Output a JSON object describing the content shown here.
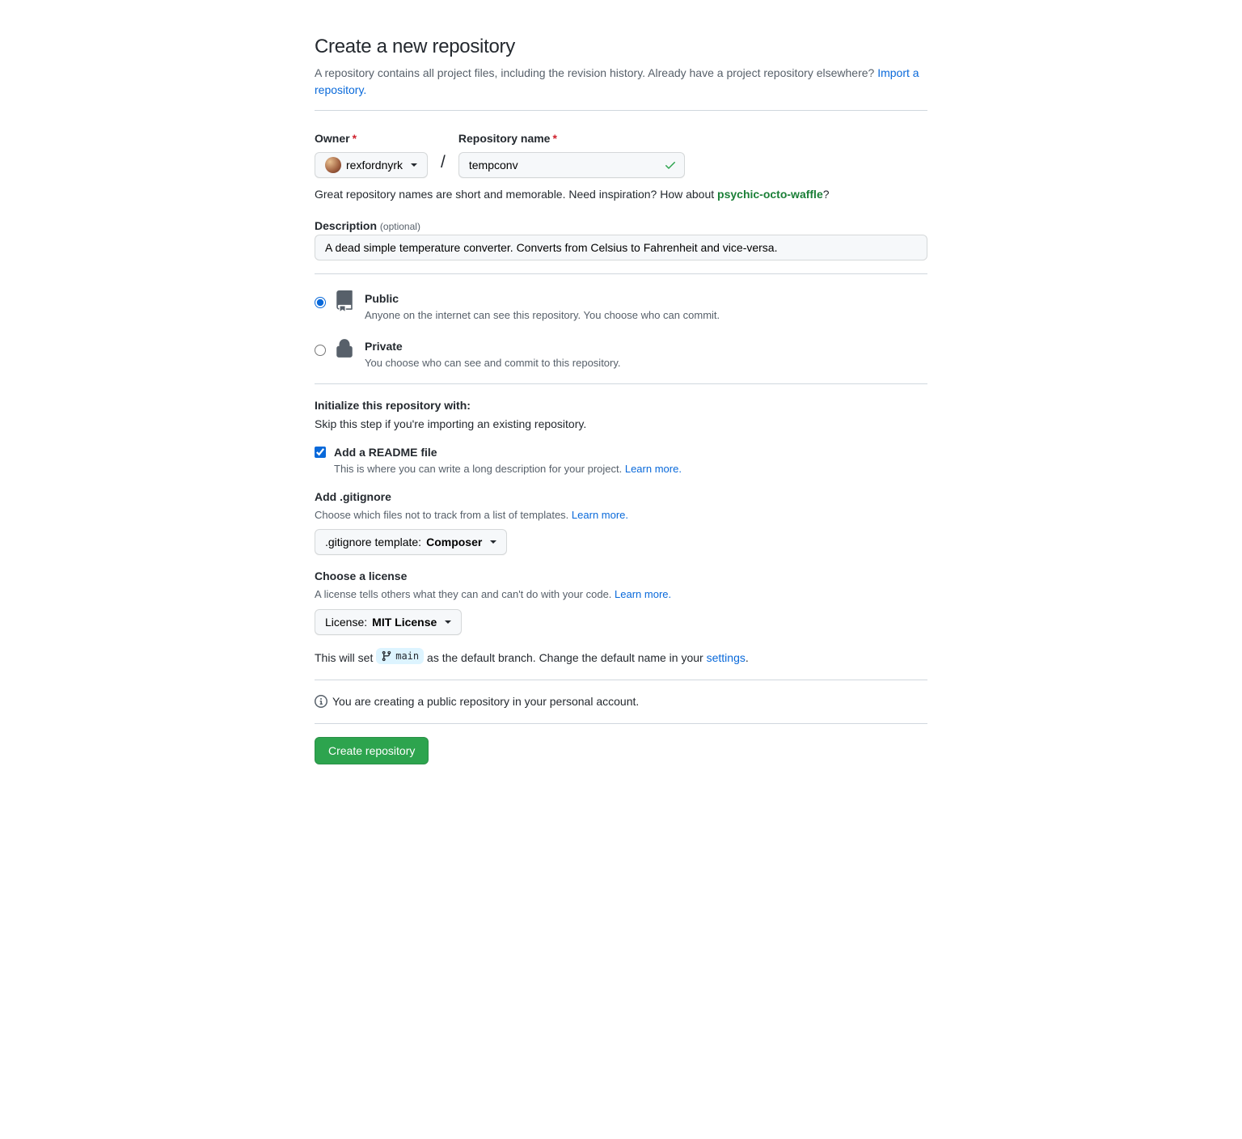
{
  "header": {
    "title": "Create a new repository",
    "subtitle_prefix": "A repository contains all project files, including the revision history. Already have a project repository elsewhere? ",
    "import_link": "Import a repository."
  },
  "owner": {
    "label": "Owner",
    "value": "rexfordnyrk"
  },
  "repo_name": {
    "label": "Repository name",
    "value": "tempconv"
  },
  "name_hint": {
    "prefix": "Great repository names are short and memorable. Need inspiration? How about ",
    "suggestion": "psychic-octo-waffle",
    "suffix": "?"
  },
  "description": {
    "label": "Description",
    "optional": "(optional)",
    "value": "A dead simple temperature converter. Converts from Celsius to Fahrenheit and vice-versa."
  },
  "visibility": {
    "public": {
      "label": "Public",
      "sub": "Anyone on the internet can see this repository. You choose who can commit."
    },
    "private": {
      "label": "Private",
      "sub": "You choose who can see and commit to this repository."
    }
  },
  "initialize": {
    "header": "Initialize this repository with:",
    "sub": "Skip this step if you're importing an existing repository."
  },
  "readme": {
    "label": "Add a README file",
    "sub_prefix": "This is where you can write a long description for your project. ",
    "learn_more": "Learn more."
  },
  "gitignore": {
    "label": "Add .gitignore",
    "sub_prefix": "Choose which files not to track from a list of templates. ",
    "learn_more": "Learn more.",
    "dropdown_prefix": ".gitignore template: ",
    "dropdown_value": "Composer"
  },
  "license": {
    "label": "Choose a license",
    "sub_prefix": "A license tells others what they can and can't do with your code. ",
    "learn_more": "Learn more.",
    "dropdown_prefix": "License: ",
    "dropdown_value": "MIT License"
  },
  "default_branch": {
    "prefix": "This will set ",
    "branch": "main",
    "mid": " as the default branch. Change the default name in your ",
    "settings_link": "settings",
    "suffix": "."
  },
  "info_text": "You are creating a public repository in your personal account.",
  "submit_label": "Create repository"
}
